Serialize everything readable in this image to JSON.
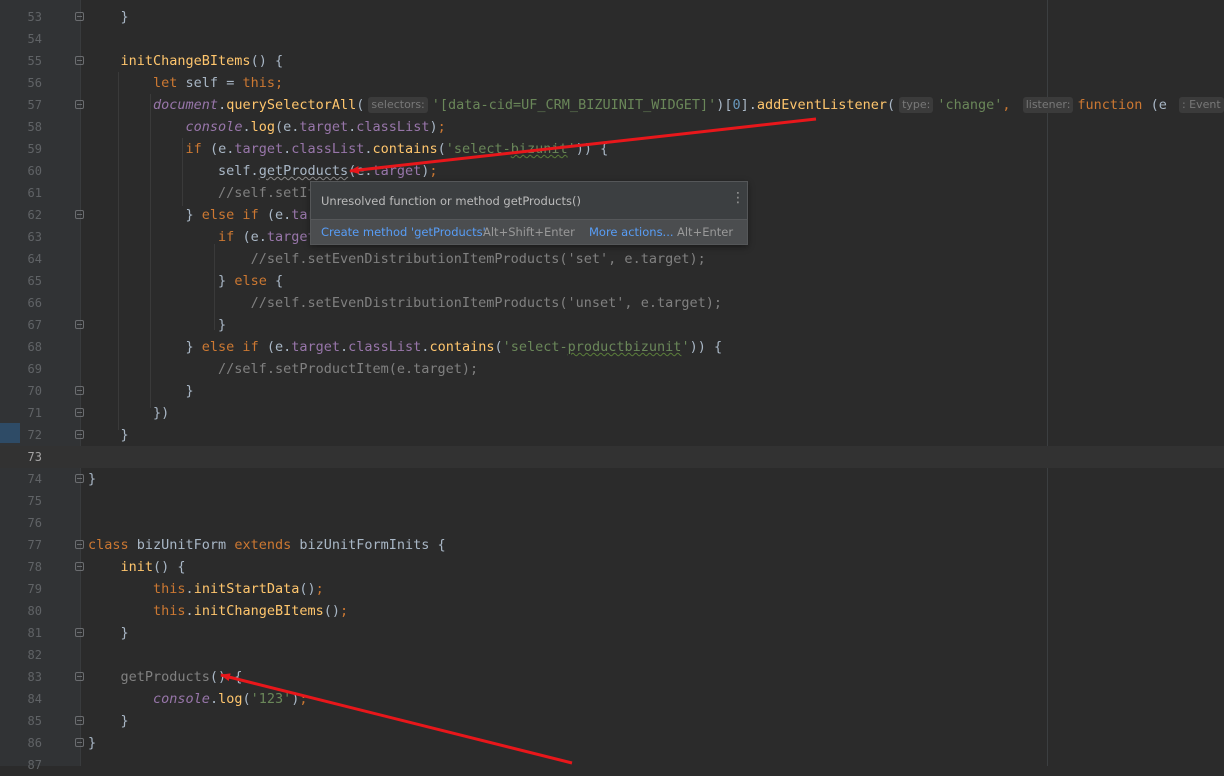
{
  "editor": {
    "lines": [
      {
        "n": "53",
        "html": "    }"
      },
      {
        "n": "54",
        "html": ""
      },
      {
        "n": "55",
        "html": "    <span class=\"fn\">initChangeBItems</span>() {"
      },
      {
        "n": "56",
        "html": "        <span class=\"k\">let</span> self = <span class=\"k\">this</span><span class=\"k\">;</span>"
      },
      {
        "n": "57",
        "html": "        <span class=\"gi\">document</span>.<span class=\"mth\">querySelectorAll</span>(<span class=\"hint\">selectors:</span><span class=\"s\">'[data-cid=UF_CRM_BIZUINIT_WIDGET]'</span>)[<span class=\"num\">0</span>].<span class=\"mth\">addEventListener</span>(<span class=\"hint\">type:</span><span class=\"s\">'change'</span><span class=\"k\">,</span> <span class=\"hint\">listener:</span><span class=\"k\">function</span> (e <span class=\"hint\">: Event</span>) {"
      },
      {
        "n": "58",
        "html": "            <span class=\"gi\">console</span>.<span class=\"mth\">log</span>(e.<span class=\"f\">target</span>.<span class=\"f\">classList</span>)<span class=\"k\">;</span>"
      },
      {
        "n": "59",
        "html": "            <span class=\"k\">if</span> (e.<span class=\"f\">target</span>.<span class=\"f\">classList</span>.<span class=\"mth\">contains</span>(<span class=\"s\">'select-<span class=\"warn\">bizunit</span>'</span>)) {"
      },
      {
        "n": "60",
        "html": "                self.<span class=\"err\">getProducts</span>(e.<span class=\"f\">target</span>)<span class=\"k\">;</span>"
      },
      {
        "n": "61",
        "html": "                <span class=\"g\">//self.setIt</span>"
      },
      {
        "n": "62",
        "html": "            } <span class=\"k\">else if</span> (e.<span class=\"f\">tar</span>"
      },
      {
        "n": "63",
        "html": "                <span class=\"k\">if</span> (e.<span class=\"f\">target</span>"
      },
      {
        "n": "64",
        "html": "                    <span class=\"g\">//self.setEvenDistributionItemProducts('set', e.target);</span>"
      },
      {
        "n": "65",
        "html": "                } <span class=\"k\">else</span> {"
      },
      {
        "n": "66",
        "html": "                    <span class=\"g\">//self.setEvenDistributionItemProducts('unset', e.target);</span>"
      },
      {
        "n": "67",
        "html": "                }"
      },
      {
        "n": "68",
        "html": "            } <span class=\"k\">else if</span> (e.<span class=\"f\">target</span>.<span class=\"f\">classList</span>.<span class=\"mth\">contains</span>(<span class=\"s\">'select-<span class=\"warn\">productbizunit</span>'</span>)) {"
      },
      {
        "n": "69",
        "html": "                <span class=\"g\">//self.setProductItem(e.target);</span>"
      },
      {
        "n": "70",
        "html": "            }"
      },
      {
        "n": "71",
        "html": "        })"
      },
      {
        "n": "72",
        "html": "    }"
      },
      {
        "n": "73",
        "html": "",
        "current": true
      },
      {
        "n": "74",
        "html": "}"
      },
      {
        "n": "75",
        "html": ""
      },
      {
        "n": "76",
        "html": ""
      },
      {
        "n": "77",
        "html": "<span class=\"k\">class</span> bizUnitForm <span class=\"k\">extends</span> bizUnitFormInits {"
      },
      {
        "n": "78",
        "html": "    <span class=\"fn\">init</span>() {"
      },
      {
        "n": "79",
        "html": "        <span class=\"k\">this</span>.<span class=\"mth\">initStartData</span>()<span class=\"k\">;</span>"
      },
      {
        "n": "80",
        "html": "        <span class=\"k\">this</span>.<span class=\"mth\">initChangeBItems</span>()<span class=\"k\">;</span>"
      },
      {
        "n": "81",
        "html": "    }"
      },
      {
        "n": "82",
        "html": ""
      },
      {
        "n": "83",
        "html": "    <span class=\"g\">getProducts</span>() {"
      },
      {
        "n": "84",
        "html": "        <span class=\"gi\">console</span>.<span class=\"mth\">log</span>(<span class=\"s\">'123'</span>)<span class=\"k\">;</span>"
      },
      {
        "n": "85",
        "html": "    }"
      },
      {
        "n": "86",
        "html": "}"
      },
      {
        "n": "87",
        "html": ""
      }
    ],
    "fold_lines": [
      "53",
      "55",
      "57",
      "62",
      "67",
      "70",
      "71",
      "72",
      "74",
      "77",
      "78",
      "81",
      "83",
      "85",
      "86"
    ]
  },
  "popup": {
    "message": "Unresolved function or method getProducts()",
    "menu_icon": "more-vertical-icon",
    "action_create": "Create method 'getProducts'",
    "shortcut_create": "Alt+Shift+Enter",
    "action_more": "More actions...",
    "shortcut_more": "Alt+Enter"
  },
  "annotations": {
    "arrow_color": "#e8171b"
  }
}
